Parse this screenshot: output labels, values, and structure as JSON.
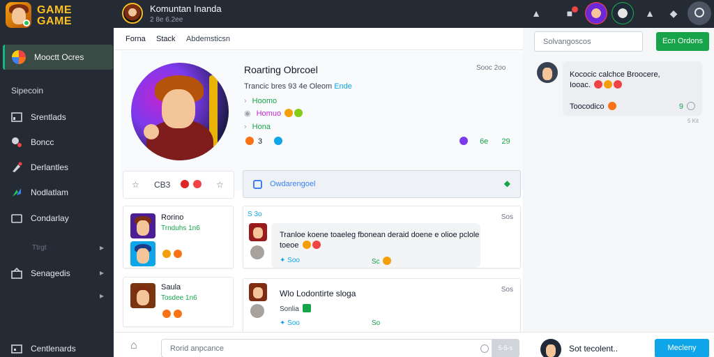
{
  "app": {
    "logo_text_1": "GAME",
    "logo_text_2": "GAME"
  },
  "sidebar": {
    "active": "Mooctt Ocres",
    "section_label": "Sipecoin",
    "items": [
      {
        "label": "Srentlads",
        "icon": "chart-icon"
      },
      {
        "label": "Boncc",
        "icon": "pin-icon"
      },
      {
        "label": "Derlantles",
        "icon": "pen-icon"
      },
      {
        "label": "Nodlatlam",
        "icon": "puzzle-icon"
      },
      {
        "label": "Condarlay",
        "icon": "folder-icon"
      }
    ],
    "sub_label": "Ttrgt",
    "settings": {
      "label": "Senagedis",
      "icon": "settings-icon"
    },
    "footer": {
      "label": "Centlenards",
      "icon": "grid-icon"
    }
  },
  "topbar": {
    "title": "Komuntan Inanda",
    "subtitle": "2 8e 6.2ee",
    "colors": {
      "bg": "#252b35",
      "accent": "#fbbf24"
    }
  },
  "tabs": [
    "Forna",
    "Stack",
    "Abdemsticsn"
  ],
  "profile": {
    "name": "Roarting Obrcoel",
    "meta_prefix": "Trancic bres 93 4e Oleom",
    "meta_link": "Ende",
    "time": "Sooc 2oo",
    "line1": "Hoomo",
    "line2": "Homuo",
    "line3": "Hona",
    "count": "3",
    "stat_a": "6e",
    "stat_b": "29"
  },
  "actions": {
    "middle": "CB3"
  },
  "status_box": {
    "label": "Owdarengoel"
  },
  "side_cards": [
    {
      "title": "Rorino",
      "sub": "Trnduhs 1n6"
    },
    {
      "title": "Saula",
      "sub": "Tosdee 1n6"
    }
  ],
  "posts": [
    {
      "head": "S 3o",
      "time": "Sos",
      "text1": "Tranloe koene toaeleg fbonean deraid doene e olioe pclole",
      "text2": "toeoe",
      "likes": "Soo",
      "count": "Sc"
    },
    {
      "title": "Wlo Lodontirte sloga",
      "sub": "Sonlia",
      "time": "Sos",
      "likes": "Soo",
      "count": "So"
    }
  ],
  "right": {
    "search_placeholder": "Solvangoscos",
    "button": "Ecn Ordons",
    "message": {
      "line1": "Kococic calchce Broocere,",
      "line2": "Iooac.",
      "footer": "Toocodico",
      "count": "9"
    },
    "time": "5 Kit"
  },
  "bottom": {
    "input_placeholder": "Rorid anpcance",
    "send": "5-5-s",
    "user_name": "Sot tecolent..",
    "button": "Mecleny"
  }
}
